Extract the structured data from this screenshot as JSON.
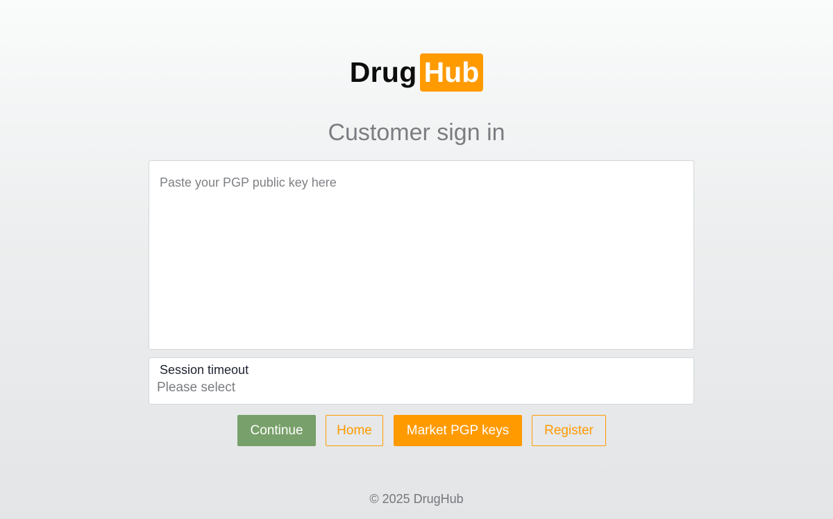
{
  "brand": {
    "logo_left": "Drug",
    "logo_right": "Hub",
    "accent_color": "#ff9a00"
  },
  "page": {
    "title": "Customer sign in"
  },
  "form": {
    "pgp_placeholder": "Paste your PGP public key here",
    "session_label": "Session timeout",
    "session_value": "Please select"
  },
  "actions": {
    "continue_label": "Continue",
    "home_label": "Home",
    "market_keys_label": "Market PGP keys",
    "register_label": "Register",
    "continue_color": "#78a06a"
  },
  "footer": {
    "copyright": "© 2025 DrugHub"
  }
}
